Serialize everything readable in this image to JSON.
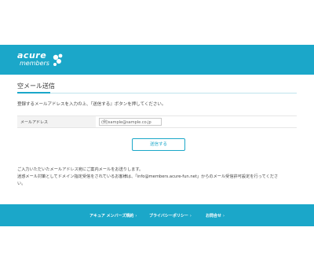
{
  "header": {
    "logo_line1": "acure",
    "logo_line2": "members"
  },
  "page": {
    "title": "空メール送信",
    "instruction": "登録するメールアドレスを入力の上、『送信する』ボタンを押してください。"
  },
  "form": {
    "email_label": "メールアドレス",
    "email_value": "(例)sample@sample.co.jp",
    "send_label": "送信する"
  },
  "notes": [
    "ご入力いただいたメールアドレス宛にご案内メールをお送りします。",
    "迷惑メール対策としてドメイン指定受信をされているお客様は、「info@members.acure-fun.net」からのメール受信許可設定を行ってくださ",
    "い。"
  ],
  "footer": {
    "links": [
      {
        "label": "アキュア メンバーズ規約",
        "chevron": "›"
      },
      {
        "label": "プライバシーポリシー",
        "chevron": "›"
      },
      {
        "label": "お問合せ",
        "chevron": "›"
      }
    ]
  },
  "colors": {
    "brand": "#1ba7c9",
    "text": "#333333",
    "label_bg": "#f3f3f3"
  }
}
